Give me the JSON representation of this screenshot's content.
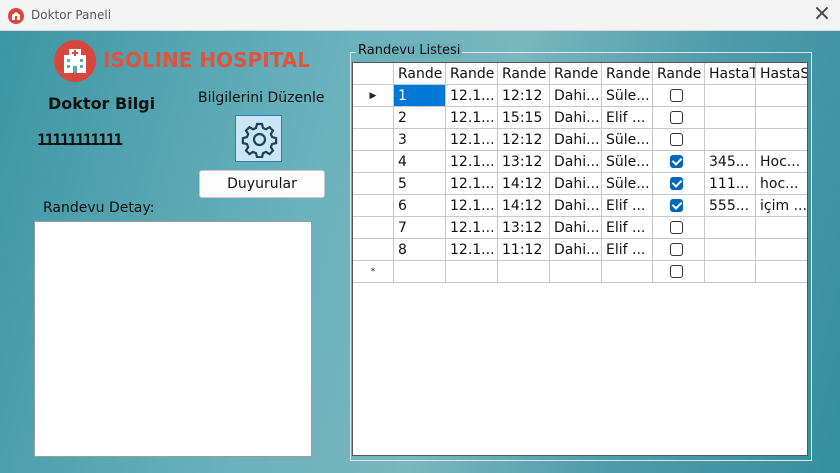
{
  "window": {
    "title": "Doktor Paneli",
    "close_glyph": "×"
  },
  "brand": {
    "name": "ISOLINE HOSPITAL",
    "color": "#e0533d"
  },
  "doctor": {
    "title": "Doktor Bilgi",
    "id_number": "11111111111"
  },
  "actions": {
    "edit_label": "Bilgilerini Düzenle",
    "announcements_label": "Duyurular"
  },
  "detail": {
    "label": "Randevu Detay:"
  },
  "appointments": {
    "group_title": "Randevu Listesi",
    "columns": [
      "Rande",
      "Rande",
      "Rande",
      "Rande",
      "Rande",
      "Rande",
      "HastaT",
      "HastaS"
    ],
    "rows": [
      {
        "c0": "1",
        "c1": "12.1...",
        "c2": "12:12",
        "c3": "Dahi...",
        "c4": "Süle...",
        "checked": false,
        "c6": "",
        "c7": ""
      },
      {
        "c0": "2",
        "c1": "12.1...",
        "c2": "15:15",
        "c3": "Dahi...",
        "c4": "Elif ...",
        "checked": false,
        "c6": "",
        "c7": ""
      },
      {
        "c0": "3",
        "c1": "12.1...",
        "c2": "12:12",
        "c3": "Dahi...",
        "c4": "Süle...",
        "checked": false,
        "c6": "",
        "c7": ""
      },
      {
        "c0": "4",
        "c1": "12.1...",
        "c2": "13:12",
        "c3": "Dahi...",
        "c4": "Süle...",
        "checked": true,
        "c6": "345...",
        "c7": "Hoc..."
      },
      {
        "c0": "5",
        "c1": "12.1...",
        "c2": "14:12",
        "c3": "Dahi...",
        "c4": "Süle...",
        "checked": true,
        "c6": "111...",
        "c7": "hoc..."
      },
      {
        "c0": "6",
        "c1": "12.1...",
        "c2": "14:12",
        "c3": "Dahi...",
        "c4": "Elif ...",
        "checked": true,
        "c6": "555...",
        "c7": "içim ..."
      },
      {
        "c0": "7",
        "c1": "12.1...",
        "c2": "13:12",
        "c3": "Dahi...",
        "c4": "Elif ...",
        "checked": false,
        "c6": "",
        "c7": ""
      },
      {
        "c0": "8",
        "c1": "12.1...",
        "c2": "11:12",
        "c3": "Dahi...",
        "c4": "Elif ...",
        "checked": false,
        "c6": "",
        "c7": ""
      }
    ],
    "current_row_glyph": "▶",
    "new_row_glyph": "*"
  }
}
